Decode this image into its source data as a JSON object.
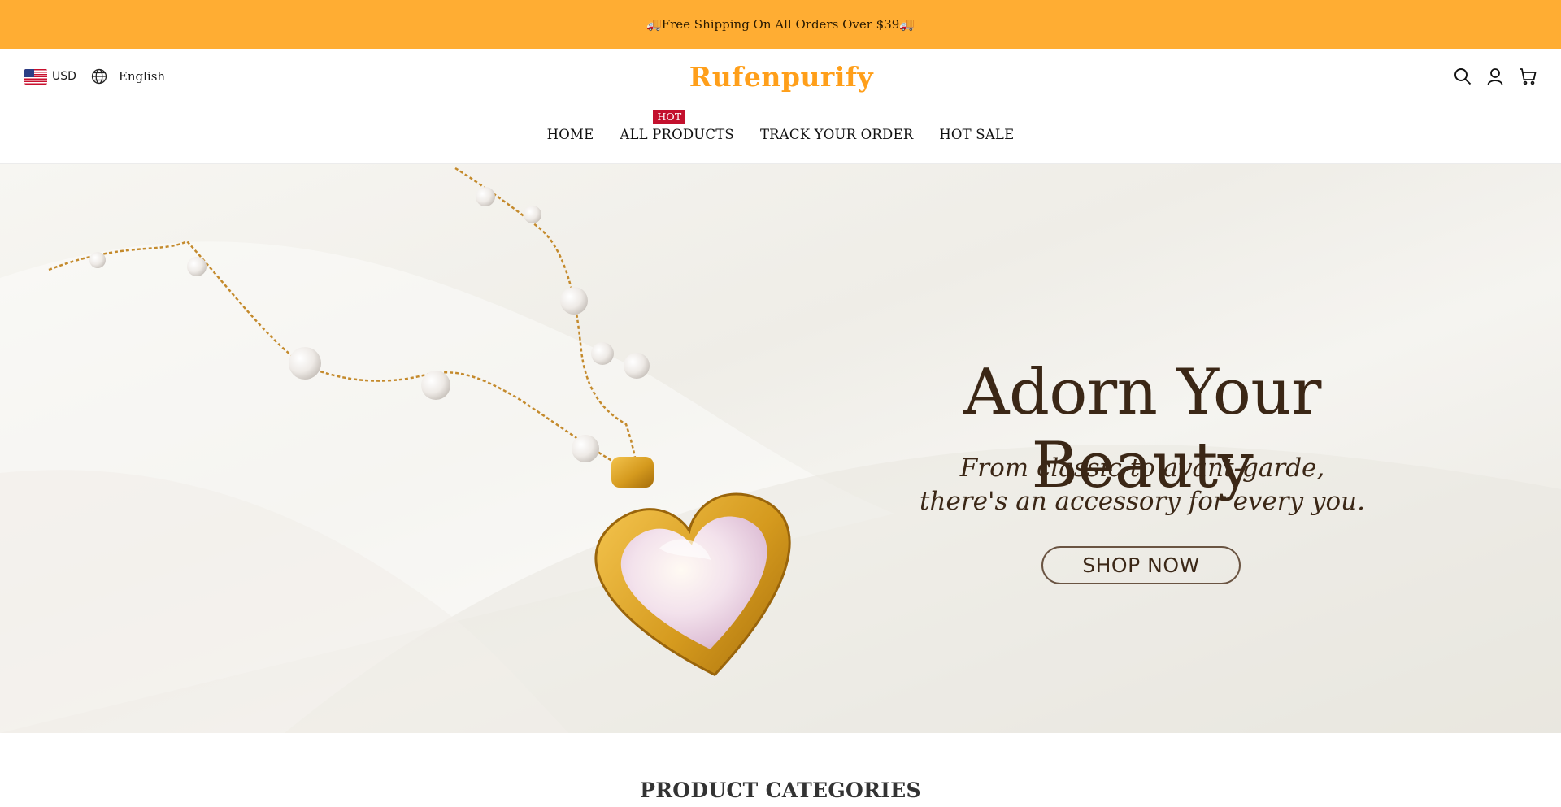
{
  "announcement": {
    "text": "🚚Free Shipping On All Orders Over $39🚚"
  },
  "header": {
    "currency": "USD",
    "language": "English",
    "logo_text": "Rufenpurify",
    "icons": [
      "search-icon",
      "account-icon",
      "cart-icon"
    ]
  },
  "nav": {
    "items": [
      {
        "label": "HOME"
      },
      {
        "label": "ALL PRODUCTS",
        "badge": "HOT"
      },
      {
        "label": "TRACK YOUR ORDER"
      },
      {
        "label": "HOT SALE"
      }
    ]
  },
  "hero": {
    "title": "Adorn Your Beauty",
    "subtitle_line1": "From classic to avant-garde,",
    "subtitle_line2": "there's an accessory for every you.",
    "cta": "SHOP NOW"
  },
  "section": {
    "title": "PRODUCT CATEGORIES"
  },
  "colors": {
    "announcement_bg": "#ffad33",
    "brand_orange": "#ff9f1a",
    "hot_badge": "#c3102d",
    "hero_text": "#3b2716"
  }
}
